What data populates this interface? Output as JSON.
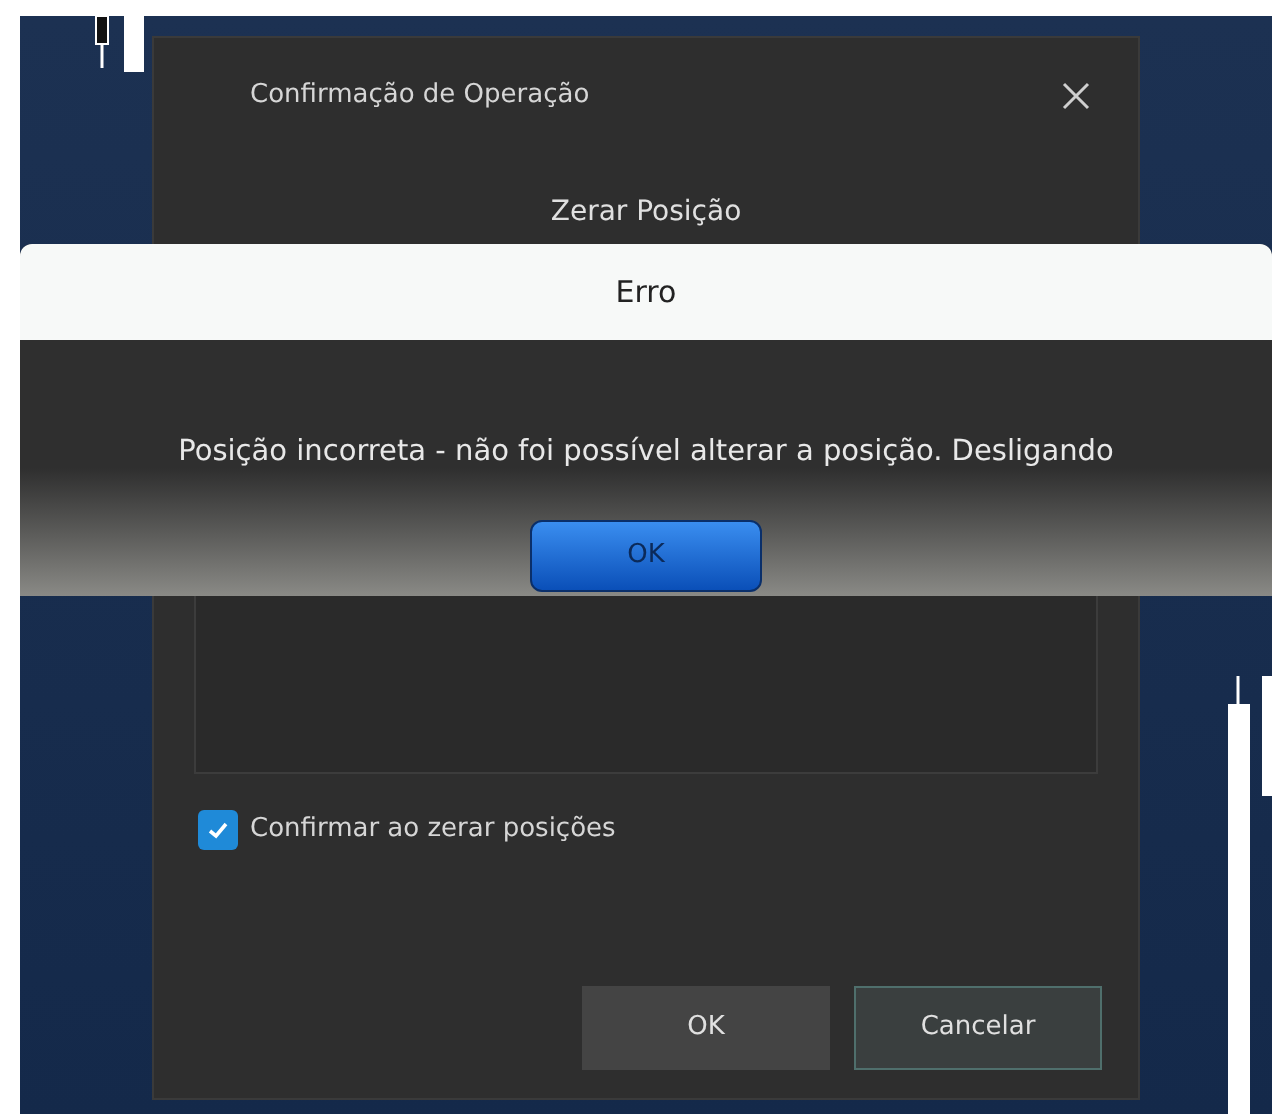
{
  "dialog": {
    "title": "Confirmação de Operação",
    "heading": "Zerar Posição",
    "confirm_checkbox": {
      "label": "Confirmar ao zerar posições",
      "checked": true
    },
    "buttons": [
      "OK",
      "Cancelar"
    ]
  },
  "error_dialog": {
    "title": "Erro",
    "message": "Posição incorreta - não foi possível alterar a posição. Desligando",
    "button": "OK"
  }
}
